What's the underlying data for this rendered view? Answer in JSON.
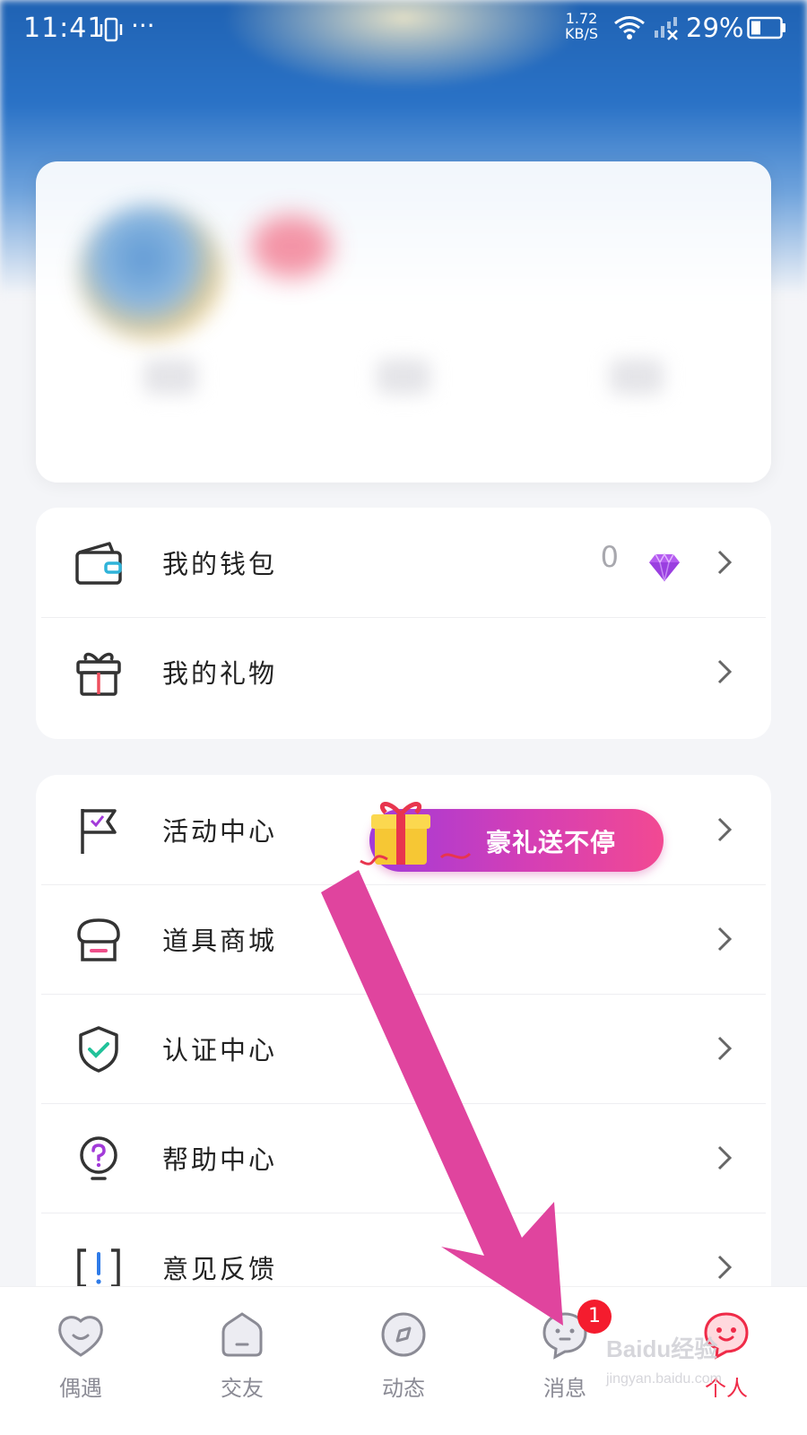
{
  "status_bar": {
    "time": "11:41",
    "dots": "···",
    "speed_value": "1.72",
    "speed_unit": "KB/S",
    "battery": "29%"
  },
  "menu_group_1": [
    {
      "label": "我的钱包",
      "value": "0",
      "icon": "wallet-icon"
    },
    {
      "label": "我的礼物",
      "icon": "gift-box-icon"
    }
  ],
  "menu_group_2": [
    {
      "label": "活动中心",
      "icon": "flag-icon",
      "promo": "豪礼送不停"
    },
    {
      "label": "道具商城",
      "icon": "store-icon"
    },
    {
      "label": "认证中心",
      "icon": "shield-check-icon"
    },
    {
      "label": "帮助中心",
      "icon": "help-bulb-icon"
    },
    {
      "label": "意见反馈",
      "icon": "feedback-icon"
    }
  ],
  "tabs": [
    {
      "label": "偶遇",
      "icon": "heart-face-icon"
    },
    {
      "label": "交友",
      "icon": "home-icon"
    },
    {
      "label": "动态",
      "icon": "compass-icon"
    },
    {
      "label": "消息",
      "icon": "message-face-icon",
      "badge": "1"
    },
    {
      "label": "个人",
      "icon": "profile-face-icon",
      "active": true
    }
  ],
  "watermark": {
    "brand": "Baidu经验",
    "url": "jingyan.baidu.com"
  },
  "colors": {
    "accent": "#ef2b48",
    "arrow": "#e0449e",
    "promo_start": "#a23ad9",
    "promo_end": "#f24992"
  }
}
